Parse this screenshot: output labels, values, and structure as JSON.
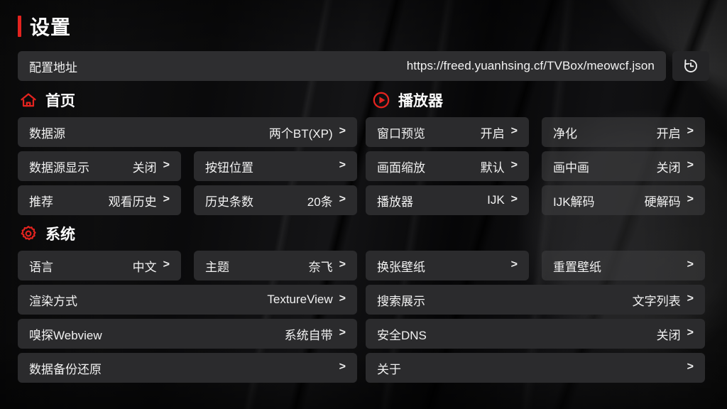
{
  "header": {
    "title": "设置",
    "accent_color": "#e3231f"
  },
  "config_address": {
    "label": "配置地址",
    "value": "https://freed.yuanhsing.cf/TVBox/meowcf.json",
    "history_button_icon": "history-icon"
  },
  "sections": [
    {
      "id": "home",
      "title": "首页",
      "icon": "home-icon",
      "icon_color": "#e3231f",
      "column": "left"
    },
    {
      "id": "player",
      "title": "播放器",
      "icon": "play-circle-icon",
      "icon_color": "#e3231f",
      "column": "right"
    },
    {
      "id": "system",
      "title": "系统",
      "icon": "gear-icon",
      "icon_color": "#e3231f",
      "column": "left"
    }
  ],
  "left_column": {
    "home_rows": [
      {
        "label": "数据源",
        "value": "两个BT(XP)",
        "chevron": ">"
      },
      {
        "label": "数据源显示",
        "value": "关闭",
        "chevron": ">"
      },
      {
        "label": "按钮位置",
        "value": "",
        "chevron": ">"
      },
      {
        "label": "推荐",
        "value": "观看历史",
        "chevron": ">"
      },
      {
        "label": "历史条数",
        "value": "20条",
        "chevron": ">"
      }
    ],
    "system_rows": [
      {
        "label": "语言",
        "value": "中文",
        "chevron": ">"
      },
      {
        "label": "主题",
        "value": "奈飞",
        "chevron": ">"
      },
      {
        "label": "渲染方式",
        "value": "TextureView",
        "chevron": ">"
      },
      {
        "label": "嗅探Webview",
        "value": "系统自带",
        "chevron": ">"
      },
      {
        "label": "数据备份还原",
        "value": "",
        "chevron": ">"
      }
    ]
  },
  "right_column": {
    "player_rows": [
      {
        "label": "窗口预览",
        "value": "开启",
        "chevron": ">"
      },
      {
        "label": "净化",
        "value": "开启",
        "chevron": ">"
      },
      {
        "label": "画面缩放",
        "value": "默认",
        "chevron": ">"
      },
      {
        "label": "画中画",
        "value": "关闭",
        "chevron": ">"
      },
      {
        "label": "播放器",
        "value": "IJK",
        "chevron": ">"
      },
      {
        "label": "IJK解码",
        "value": "硬解码",
        "chevron": ">"
      }
    ],
    "system_rows": [
      {
        "label": "换张壁纸",
        "value": "",
        "chevron": ">"
      },
      {
        "label": "重置壁纸",
        "value": "",
        "chevron": ">"
      },
      {
        "label": "搜索展示",
        "value": "文字列表",
        "chevron": ">"
      },
      {
        "label": "安全DNS",
        "value": "关闭",
        "chevron": ">"
      },
      {
        "label": "关于",
        "value": "",
        "chevron": ">"
      }
    ]
  }
}
